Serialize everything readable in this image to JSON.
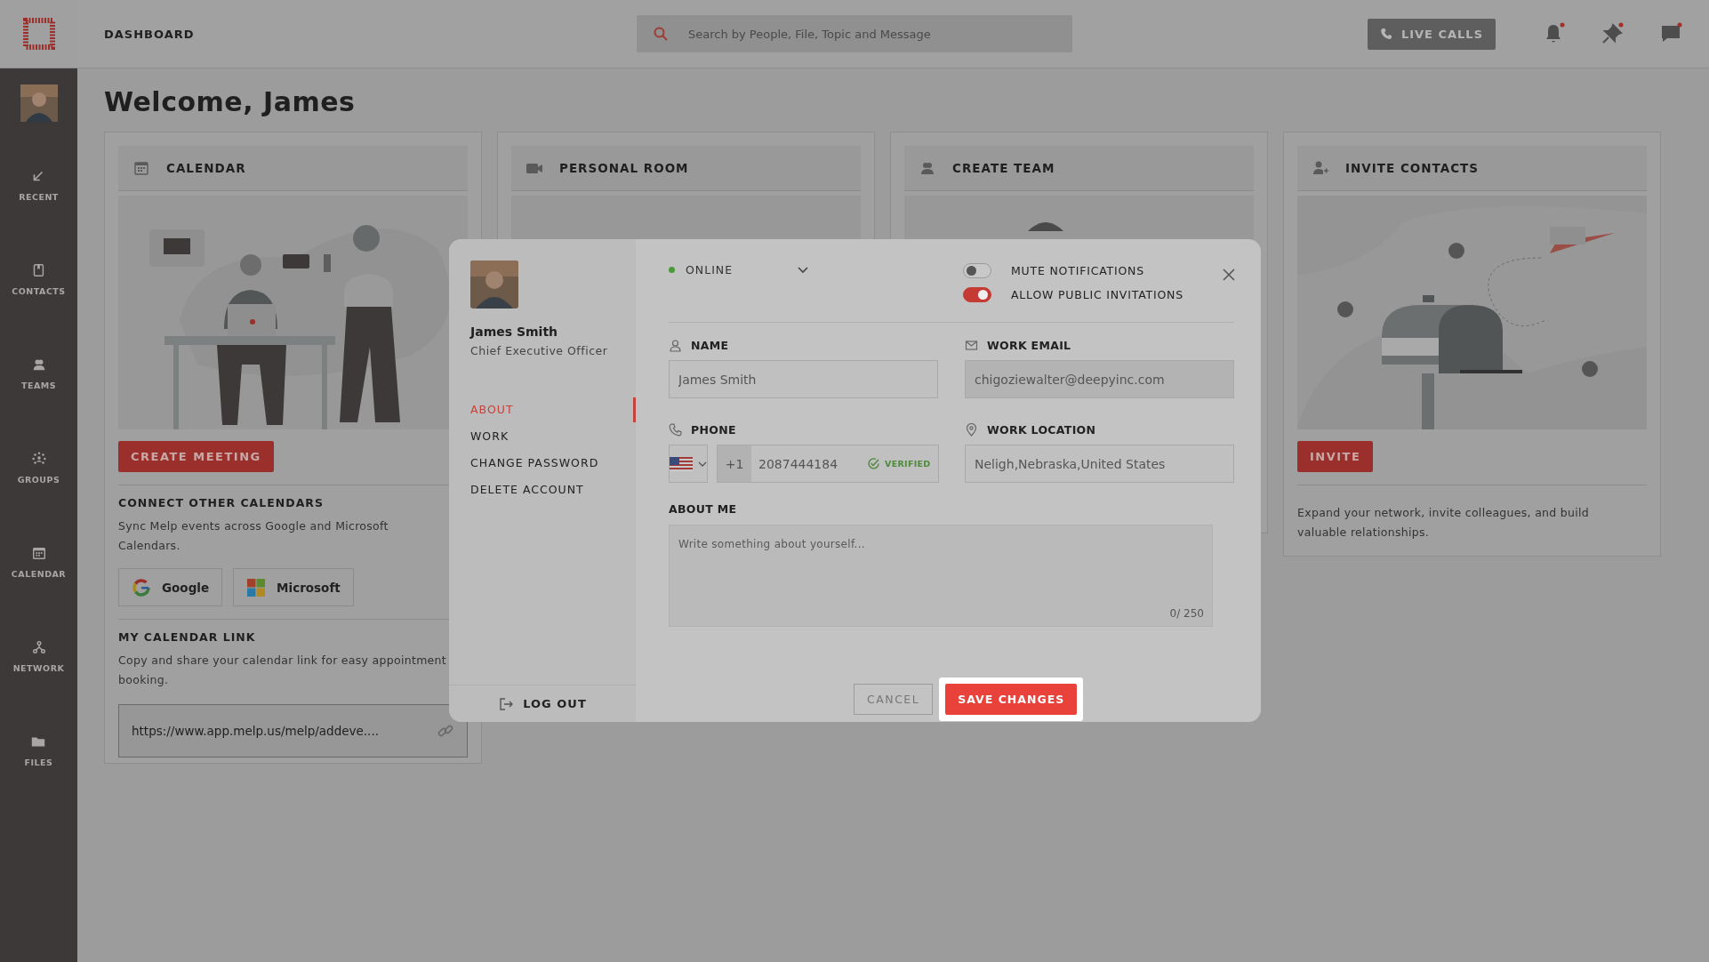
{
  "topbar": {
    "title": "DASHBOARD",
    "search": {
      "placeholder": "Search by People, File, Topic and Message"
    },
    "live_calls": "LIVE CALLS",
    "icons": [
      {
        "kind": "bell",
        "unread": true
      },
      {
        "kind": "pin",
        "unread": true
      },
      {
        "kind": "chat",
        "unread": true
      }
    ]
  },
  "sidebar": {
    "items": [
      {
        "kind": "recent",
        "label": "RECENT"
      },
      {
        "kind": "contacts",
        "label": "CONTACTS"
      },
      {
        "kind": "teams",
        "label": "TEAMS"
      },
      {
        "kind": "groups",
        "label": "GROUPS"
      },
      {
        "kind": "calendar",
        "label": "CALENDAR"
      },
      {
        "kind": "network",
        "label": "NETWORK"
      },
      {
        "kind": "files",
        "label": "FILES"
      }
    ]
  },
  "welcome": "Welcome, James",
  "cards": [
    {
      "kind": "calendar",
      "title": "CALENDAR",
      "button": "CREATE MEETING",
      "connect_title": "CONNECT OTHER CALENDARS",
      "connect_text": "Sync Melp events across Google and Microsoft Calendars.",
      "providers": [
        {
          "kind": "google",
          "label": "Google"
        },
        {
          "kind": "microsoft",
          "label": "Microsoft"
        }
      ],
      "link_title": "MY CALENDAR LINK",
      "link_text": "Copy and share your calendar link for easy appointment booking.",
      "link": "https://www.app.melp.us/melp/addeve...."
    },
    {
      "kind": "room",
      "title": "PERSONAL ROOM"
    },
    {
      "kind": "team",
      "title": "CREATE TEAM"
    },
    {
      "kind": "invite",
      "title": "INVITE CONTACTS",
      "button": "INVITE",
      "text": "Expand your network, invite colleagues, and build valuable relationships."
    }
  ],
  "modal": {
    "profile": {
      "name": "James Smith",
      "role": "Chief Executive Officer"
    },
    "nav": [
      {
        "label": "ABOUT",
        "selected": true
      },
      {
        "label": "WORK",
        "selected": false
      },
      {
        "label": "CHANGE PASSWORD",
        "selected": false
      },
      {
        "label": "DELETE ACCOUNT",
        "selected": false
      }
    ],
    "logout": "LOG OUT",
    "status": "ONLINE",
    "toggles": [
      {
        "label": "MUTE NOTIFICATIONS",
        "on": false
      },
      {
        "label": "ALLOW PUBLIC INVITATIONS",
        "on": true
      }
    ],
    "name_field": {
      "label": "NAME",
      "value": "James Smith",
      "disabled": false
    },
    "email_field": {
      "label": "WORK EMAIL",
      "value": "chigoziewalter@deepyinc.com",
      "disabled": true
    },
    "phone": {
      "label": "PHONE",
      "code": "+1",
      "value": "2087444184",
      "verified": "VERIFIED"
    },
    "location_field": {
      "label": "WORK LOCATION",
      "value": "Neligh,Nebraska,United States",
      "disabled": false
    },
    "about": {
      "label": "ABOUT ME",
      "placeholder": "Write something about yourself...",
      "counter": "0/ 250"
    },
    "cancel": "CANCEL",
    "save": "SAVE CHANGES"
  }
}
